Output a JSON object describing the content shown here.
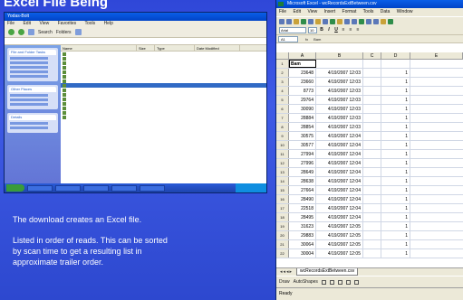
{
  "slide": {
    "title_fragment": "Excel File Being",
    "caption_line1": "The download creates an Excel file.",
    "caption_line2": "Listed in order of reads.  This can be sorted",
    "caption_line3": "by scan time to get a resulting list in",
    "caption_line4": "approximate trailer order."
  },
  "explorer": {
    "window_title": "Yodas-Bolt",
    "menu": [
      "File",
      "Edit",
      "View",
      "Favorites",
      "Tools",
      "Help"
    ],
    "toolbar_search": "Search",
    "toolbar_folders": "Folders",
    "columns": [
      "Name",
      "Size",
      "Type",
      "Date Modified"
    ],
    "task_panels": [
      "File and Folder Tasks",
      "Other Places",
      "Details"
    ]
  },
  "excel": {
    "window_title": "Microsoft Excel - wcRecordsExtBetween.csv",
    "menu": [
      "File",
      "Edit",
      "View",
      "Insert",
      "Format",
      "Tools",
      "Data",
      "Window"
    ],
    "font_name": "Arial",
    "font_size": "10",
    "name_box": "A1",
    "formula_value": "Bam",
    "columns": [
      "A",
      "B",
      "C",
      "D",
      "E"
    ],
    "header_cell": "Bam",
    "rows": [
      {
        "n": "2",
        "a": "23648",
        "b": "4/19/2007 12:03",
        "d": "1"
      },
      {
        "n": "3",
        "a": "23660",
        "b": "4/19/2007 12:03",
        "d": "1"
      },
      {
        "n": "4",
        "a": "8773",
        "b": "4/19/2007 12:03",
        "d": "1"
      },
      {
        "n": "5",
        "a": "29764",
        "b": "4/19/2007 12:03",
        "d": "1"
      },
      {
        "n": "6",
        "a": "30090",
        "b": "4/19/2007 12:03",
        "d": "1"
      },
      {
        "n": "7",
        "a": "28884",
        "b": "4/19/2007 12:03",
        "d": "1"
      },
      {
        "n": "8",
        "a": "28854",
        "b": "4/19/2007 12:03",
        "d": "1"
      },
      {
        "n": "9",
        "a": "30575",
        "b": "4/19/2007 12:04",
        "d": "1"
      },
      {
        "n": "10",
        "a": "30577",
        "b": "4/19/2007 12:04",
        "d": "1"
      },
      {
        "n": "11",
        "a": "27994",
        "b": "4/19/2007 12:04",
        "d": "1"
      },
      {
        "n": "12",
        "a": "27996",
        "b": "4/19/2007 12:04",
        "d": "1"
      },
      {
        "n": "13",
        "a": "28649",
        "b": "4/19/2007 12:04",
        "d": "1"
      },
      {
        "n": "14",
        "a": "28638",
        "b": "4/19/2007 12:04",
        "d": "1"
      },
      {
        "n": "15",
        "a": "27664",
        "b": "4/19/2007 12:04",
        "d": "1"
      },
      {
        "n": "16",
        "a": "28490",
        "b": "4/19/2007 12:04",
        "d": "1"
      },
      {
        "n": "17",
        "a": "22518",
        "b": "4/19/2007 12:04",
        "d": "1"
      },
      {
        "n": "18",
        "a": "28495",
        "b": "4/19/2007 12:04",
        "d": "1"
      },
      {
        "n": "19",
        "a": "31623",
        "b": "4/19/2007 12:05",
        "d": "1"
      },
      {
        "n": "20",
        "a": "29883",
        "b": "4/19/2007 12:05",
        "d": "1"
      },
      {
        "n": "21",
        "a": "30064",
        "b": "4/19/2007 12:05",
        "d": "1"
      },
      {
        "n": "22",
        "a": "30004",
        "b": "4/19/2007 12:05",
        "d": "1"
      }
    ],
    "sheet_tab": "wcRecordsExtBetween.csv",
    "draw_label": "Draw",
    "autoshapes_label": "AutoShapes",
    "status": "Ready"
  }
}
